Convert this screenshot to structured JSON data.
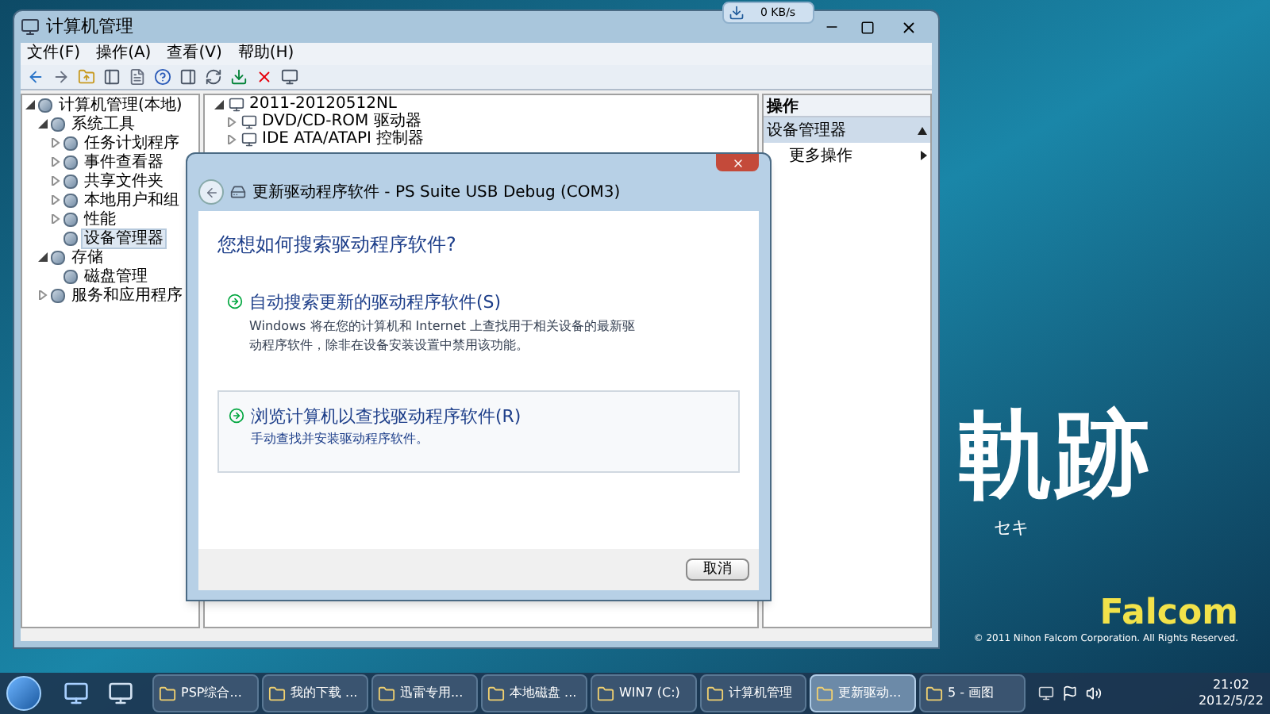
{
  "net_widget": {
    "reading": "0 KB/s"
  },
  "window": {
    "title": "计算机管理",
    "menu": [
      "文件(F)",
      "操作(A)",
      "查看(V)",
      "帮助(H)"
    ],
    "tree": [
      {
        "label": "计算机管理(本地)",
        "expanded": true,
        "selected": false,
        "children": [
          {
            "label": "系统工具",
            "expanded": true,
            "selected": false,
            "children": [
              {
                "label": "任务计划程序",
                "expanded": false,
                "selected": false
              },
              {
                "label": "事件查看器",
                "expanded": false,
                "selected": false
              },
              {
                "label": "共享文件夹",
                "expanded": false,
                "selected": false
              },
              {
                "label": "本地用户和组",
                "expanded": false,
                "selected": false
              },
              {
                "label": "性能",
                "expanded": false,
                "selected": false
              },
              {
                "label": "设备管理器",
                "selected": true
              }
            ]
          },
          {
            "label": "存储",
            "expanded": true,
            "selected": false,
            "children": [
              {
                "label": "磁盘管理",
                "selected": false
              }
            ]
          },
          {
            "label": "服务和应用程序",
            "expanded": false,
            "selected": false
          }
        ]
      }
    ],
    "devices": {
      "label": "2011-20120512NL",
      "expanded": true,
      "children": [
        {
          "label": "DVD/CD-ROM 驱动器",
          "expanded": false
        },
        {
          "label": "IDE ATA/ATAPI 控制器",
          "expanded": false
        }
      ]
    },
    "actions": {
      "header": "操作",
      "section": "设备管理器",
      "items": [
        "更多操作"
      ]
    }
  },
  "dialog": {
    "title": "更新驱动程序软件 - PS Suite USB Debug (COM3)",
    "question": "您想如何搜索驱动程序软件?",
    "options": [
      {
        "title": "自动搜索更新的驱动程序软件(S)",
        "description": "Windows 将在您的计算机和 Internet 上查找用于相关设备的最新驱动程序软件，除非在设备安装设置中禁用该功能。",
        "boxed": false
      },
      {
        "title": "浏览计算机以查找驱动程序软件(R)",
        "description": "手动查找并安装驱动程序软件。",
        "boxed": true
      }
    ],
    "cancel": "取消"
  },
  "wallpaper": {
    "logo": "軌跡",
    "subtitle": "セキ",
    "brand": "Falcom",
    "copyright": "© 2011 Nihon Falcom Corporation. All Rights Reserved."
  },
  "taskbar": {
    "items": [
      {
        "label": "PSP综合...",
        "selected": false
      },
      {
        "label": "我的下载 ...",
        "selected": false
      },
      {
        "label": "迅雷专用...",
        "selected": false
      },
      {
        "label": "本地磁盘 ...",
        "selected": false
      },
      {
        "label": "WIN7 (C:)",
        "selected": false
      },
      {
        "label": "计算机管理",
        "selected": false
      },
      {
        "label": "更新驱动...",
        "selected": true
      },
      {
        "label": "5 - 画图",
        "selected": false
      }
    ],
    "time": "21:02",
    "date": "2012/5/22"
  }
}
